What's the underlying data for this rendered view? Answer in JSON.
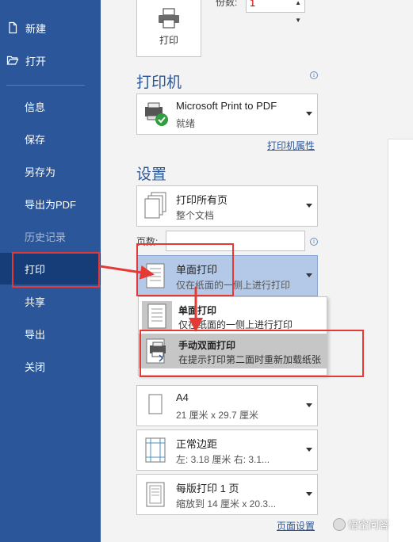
{
  "sidebar": {
    "items": [
      {
        "label": "新建",
        "icon": "new-doc-icon"
      },
      {
        "label": "打开",
        "icon": "open-folder-icon"
      },
      {
        "label": "信息"
      },
      {
        "label": "保存"
      },
      {
        "label": "另存为"
      },
      {
        "label": "导出为PDF"
      },
      {
        "label": "历史记录"
      },
      {
        "label": "打印"
      },
      {
        "label": "共享"
      },
      {
        "label": "导出"
      },
      {
        "label": "关闭"
      }
    ]
  },
  "print": {
    "button_label": "打印",
    "copies_label": "份数:",
    "copies_value": "1"
  },
  "printer": {
    "section_title": "打印机",
    "name": "Microsoft Print to PDF",
    "status": "就绪",
    "properties_link": "打印机属性"
  },
  "settings": {
    "section_title": "设置",
    "range": {
      "line1": "打印所有页",
      "line2": "整个文档"
    },
    "pages_label": "页数:",
    "pages_value": "",
    "sides": {
      "line1": "单面打印",
      "line2": "仅在纸面的一侧上进行打印"
    },
    "paper": {
      "line1": "A4",
      "line2": "21 厘米 x 29.7 厘米"
    },
    "margins": {
      "line1": "正常边距",
      "line2": "左: 3.18 厘米    右: 3.1..."
    },
    "pages_per_sheet": {
      "line1": "每版打印 1 页",
      "line2": "缩放到 14 厘米 x 20.3..."
    },
    "page_setup_link": "页面设置"
  },
  "popup": {
    "items": [
      {
        "line1": "单面打印",
        "line2": "仅在纸面的一侧上进行打印"
      },
      {
        "line1": "手动双面打印",
        "line2": "在提示打印第二面时重新加载纸张"
      }
    ]
  },
  "watermark": "悟空问答",
  "colors": {
    "sidebar_bg": "#2b579a",
    "sidebar_active": "#173d78",
    "annotation_red": "#e53935",
    "selected_dropdown": "#b4c9e8"
  }
}
